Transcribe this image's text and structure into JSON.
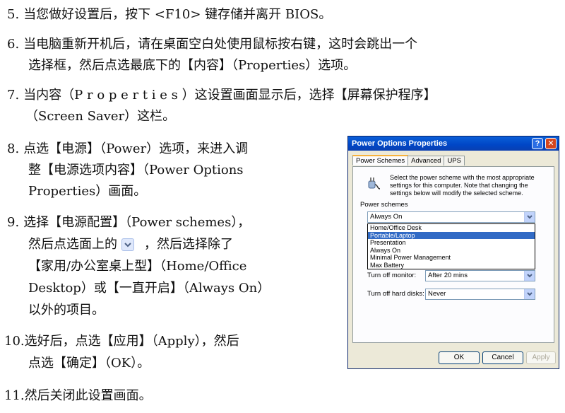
{
  "steps": [
    {
      "num": "5.",
      "lines": [
        "当您做好设置后，按下 <F10> 键存储并离开 BIOS。"
      ]
    },
    {
      "num": "6.",
      "lines": [
        "当电脑重新开机后，请在桌面空白处使用鼠标按右键，这时会跳出一个",
        "选择框，然后点选最底下的【内容】（Properties）选项。"
      ]
    },
    {
      "num": "7.",
      "lines": [
        "当内容（P r o p e r t i e s ）这设置画面显示后，选择【屏幕保护程序】",
        "（Screen Saver）这栏。"
      ]
    },
    {
      "num": "8.",
      "lines": [
        "点选【电源】（Power）选项，来进入调",
        "整【电源选项内容】（Power Options",
        "Properties）画面。"
      ]
    },
    {
      "num": "9.",
      "lines": [
        "选择【电源配置】（Power schemes），",
        "【家用/办公室桌上型】（Home/Office",
        "Desktop）或【一直开启】（Always On）",
        "以外的项目。"
      ],
      "line2_pre": "然后点选面上的",
      "line2_post": "，然后选择除了"
    },
    {
      "num": "10.",
      "lines": [
        "选好后，点选【应用】（Apply），然后",
        "点选【确定】（OK）。"
      ]
    },
    {
      "num": "11.",
      "lines": [
        "然后关闭此设置画面。"
      ]
    }
  ],
  "dialog": {
    "title": "Power Options Properties",
    "help_glyph": "?",
    "close_glyph": "✕",
    "tabs": [
      "Power Schemes",
      "Advanced",
      "UPS"
    ],
    "description": "Select the power scheme with the most appropriate settings for this computer. Note that changing the settings below will modify the selected scheme.",
    "group_label": "Power schemes",
    "group_label_accel": "w",
    "selected_scheme": "Always On",
    "options": [
      "Home/Office Desk",
      "Portable/Laptop",
      "Presentation",
      "Always On",
      "Minimal Power Management",
      "Max Battery"
    ],
    "highlighted_option": "Portable/Laptop",
    "monitor_label": "Turn off monitor:",
    "monitor_value": "After 20 mins",
    "disks_label": "Turn off hard disks:",
    "disks_value": "Never",
    "ok_label": "OK",
    "cancel_label": "Cancel",
    "apply_label": "Apply"
  }
}
